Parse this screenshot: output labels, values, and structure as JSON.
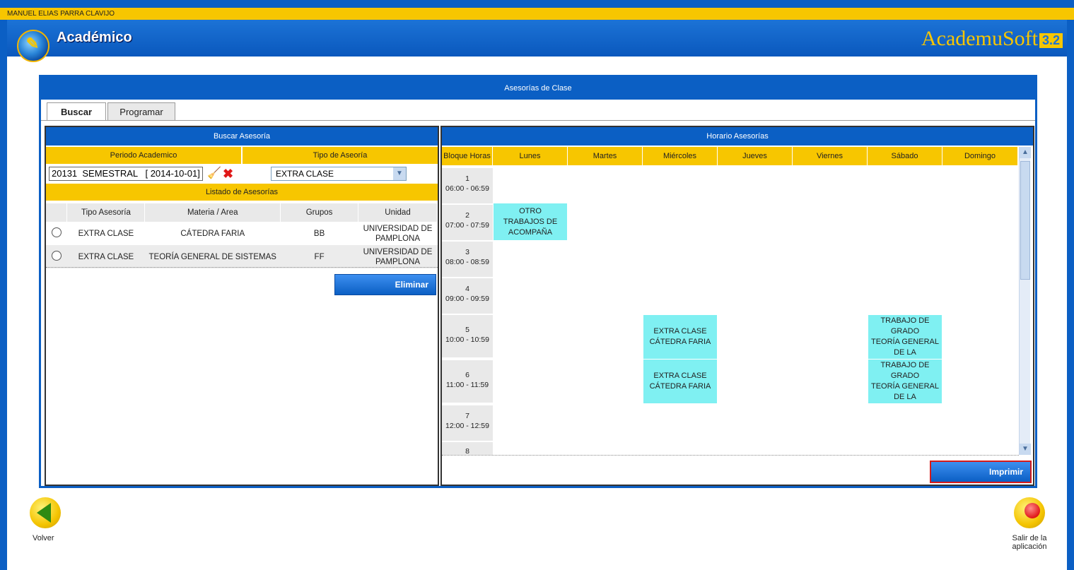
{
  "user": "MANUEL ELIAS PARRA CLAVIJO",
  "header": {
    "module": "Académico",
    "brand": "AcademuSoft",
    "version": "3.2"
  },
  "main": {
    "title": "Asesorías de Clase"
  },
  "tabs": [
    {
      "label": "Buscar"
    },
    {
      "label": "Programar"
    }
  ],
  "search": {
    "title": "Buscar Asesoría",
    "period_label": "Periodo Academico",
    "type_label": "Tipo de Aseoría",
    "period_value": "20131  SEMESTRAL   [ 2014-10-01]",
    "type_value": "EXTRA CLASE",
    "list_title": "Listado de Asesorías",
    "columns": [
      "Tipo Asesoría",
      "Materia / Area",
      "Grupos",
      "Unidad"
    ],
    "rows": [
      {
        "tipo": "EXTRA CLASE",
        "materia": "CÁTEDRA FARIA",
        "grupo": "BB",
        "unidad1": "UNIVERSIDAD DE",
        "unidad2": "PAMPLONA"
      },
      {
        "tipo": "EXTRA CLASE",
        "materia": "TEORÍA GENERAL DE SISTEMAS",
        "grupo": "FF",
        "unidad1": "UNIVERSIDAD DE",
        "unidad2": "PAMPLONA"
      }
    ],
    "delete_label": "Eliminar"
  },
  "schedule": {
    "title": "Horario Asesorías",
    "columns": [
      "Bloque Horas",
      "Lunes",
      "Martes",
      "Miércoles",
      "Jueves",
      "Viernes",
      "Sábado",
      "Domingo"
    ],
    "blocks": [
      {
        "num": "1",
        "range": "06:00 - 06:59"
      },
      {
        "num": "2",
        "range": "07:00 - 07:59"
      },
      {
        "num": "3",
        "range": "08:00 - 08:59"
      },
      {
        "num": "4",
        "range": "09:00 - 09:59"
      },
      {
        "num": "5",
        "range": "10:00 - 10:59"
      },
      {
        "num": "6",
        "range": "11:00 - 11:59"
      },
      {
        "num": "7",
        "range": "12:00 - 12:59"
      },
      {
        "num": "8",
        "range": ""
      }
    ],
    "events": [
      {
        "lines": [
          "OTRO",
          "TRABAJOS DE",
          "ACOMPAÑA"
        ]
      },
      {
        "lines": [
          "EXTRA CLASE",
          "CÁTEDRA FARIA"
        ]
      },
      {
        "lines": [
          "EXTRA CLASE",
          "CÁTEDRA FARIA"
        ]
      },
      {
        "lines": [
          "TRABAJO DE",
          "GRADO",
          "TEORÍA GENERAL",
          "DE LA"
        ]
      },
      {
        "lines": [
          "TRABAJO DE",
          "GRADO",
          "TEORÍA GENERAL",
          "DE LA"
        ]
      }
    ],
    "print_label": "Imprimir"
  },
  "footer": {
    "back_label": "Volver",
    "exit_label_1": "Salir de la",
    "exit_label_2": "aplicación"
  },
  "colors": {
    "blue": "#0b5fc4",
    "yellow": "#f7c600",
    "cyan": "#7ff0f2",
    "red_outline": "#d61b1b"
  },
  "icons": [
    "logo-icon",
    "broom-icon",
    "clear-icon",
    "dropdown-arrow-icon",
    "scroll-up-icon",
    "scroll-down-icon",
    "back-arrow-icon",
    "exit-icon"
  ]
}
